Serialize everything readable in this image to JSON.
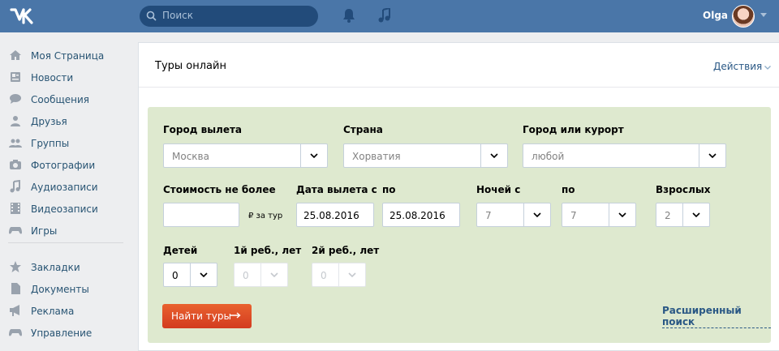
{
  "topbar": {
    "search_placeholder": "Поиск",
    "user_name": "Olga"
  },
  "sidebar": {
    "items": [
      {
        "label": "Моя Страница",
        "icon": "home-icon"
      },
      {
        "label": "Новости",
        "icon": "news-icon"
      },
      {
        "label": "Сообщения",
        "icon": "messages-icon"
      },
      {
        "label": "Друзья",
        "icon": "friend-icon"
      },
      {
        "label": "Группы",
        "icon": "groups-icon"
      },
      {
        "label": "Фотографии",
        "icon": "camera-icon"
      },
      {
        "label": "Аудиозаписи",
        "icon": "music-icon"
      },
      {
        "label": "Видеозаписи",
        "icon": "film-icon"
      },
      {
        "label": "Игры",
        "icon": "gamepad-icon"
      },
      {
        "label": "Закладки",
        "icon": "star-icon"
      },
      {
        "label": "Документы",
        "icon": "document-icon"
      },
      {
        "label": "Реклама",
        "icon": "megaphone-icon"
      },
      {
        "label": "Управление",
        "icon": "gamepad-icon"
      }
    ]
  },
  "main": {
    "title": "Туры онлайн",
    "actions_label": "Действия"
  },
  "form": {
    "departure_city": {
      "label": "Город вылета",
      "value": "Москва"
    },
    "country": {
      "label": "Страна",
      "value": "Хорватия"
    },
    "resort": {
      "label": "Город или курорт",
      "value": "любой"
    },
    "price": {
      "label": "Стоимость не более",
      "value": "",
      "unit": "₽ за тур"
    },
    "date_from": {
      "label": "Дата вылета с",
      "value": "25.08.2016"
    },
    "date_to": {
      "label": "по",
      "value": "25.08.2016"
    },
    "nights_from": {
      "label": "Ночей с",
      "value": "7"
    },
    "nights_to": {
      "label": "по",
      "value": "7"
    },
    "adults": {
      "label": "Взрослых",
      "value": "2"
    },
    "children": {
      "label": "Детей",
      "value": "0"
    },
    "child1_age": {
      "label": "1й реб., лет",
      "value": "0"
    },
    "child2_age": {
      "label": "2й реб., лет",
      "value": "0"
    },
    "submit_label": "Найти туры",
    "advanced_label": "Расширенный поиск"
  },
  "colors": {
    "header": "#4a76a8",
    "form_bg": "#dee9cf",
    "button": "#e1522a",
    "link": "#2a5885"
  }
}
